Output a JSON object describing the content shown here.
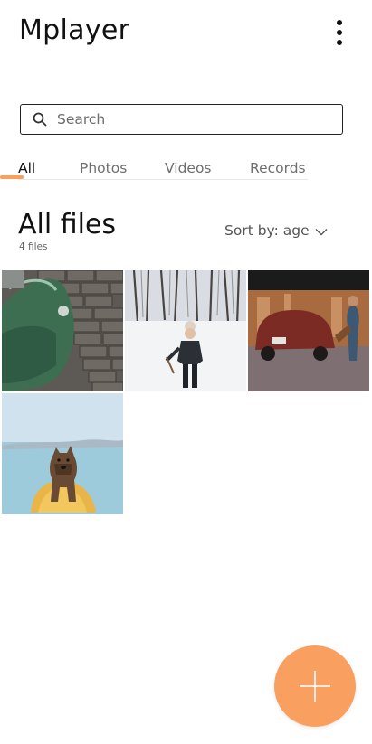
{
  "app": {
    "title": "Mplayer"
  },
  "header": {
    "menu_icon": "more-vertical-icon"
  },
  "search": {
    "placeholder": "Search",
    "value": "",
    "icon": "search-icon"
  },
  "tabs": [
    {
      "label": "All",
      "active": true
    },
    {
      "label": "Photos",
      "active": false
    },
    {
      "label": "Videos",
      "active": false
    },
    {
      "label": "Records",
      "active": false
    }
  ],
  "section": {
    "title": "All files",
    "count_label": "4 files"
  },
  "sort": {
    "label": "Sort by: age",
    "icon": "chevron-down-icon"
  },
  "files": [
    {
      "thumbnail": "photo-green-car-brick-wall"
    },
    {
      "thumbnail": "photo-woman-snowy-forest"
    },
    {
      "thumbnail": "photo-red-vintage-car-mural"
    },
    {
      "thumbnail": "photo-dog-on-yellow-kayak"
    }
  ],
  "fab": {
    "icon": "plus-icon"
  },
  "colors": {
    "accent": "#f9a060",
    "tab_indicator": "#f8a05c",
    "text": "#111111",
    "muted": "#6e6e6e"
  }
}
